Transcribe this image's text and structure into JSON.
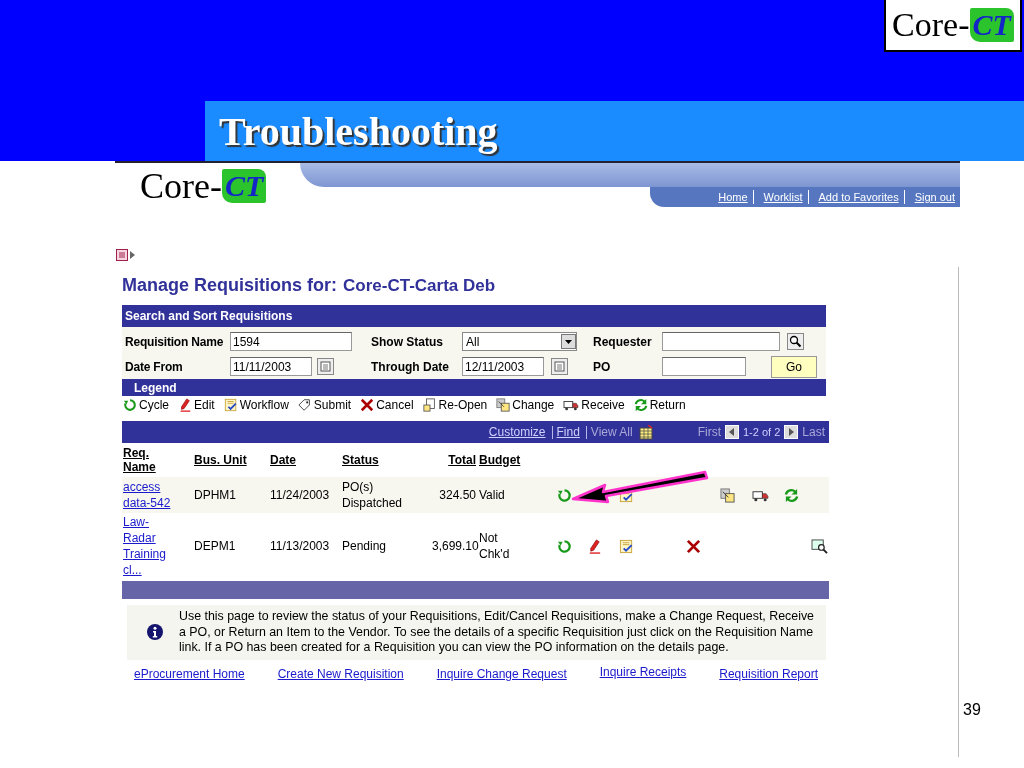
{
  "slide": {
    "title": "Troubleshooting",
    "logo": {
      "text": "Core-",
      "mark": "CT"
    },
    "page_number": "39"
  },
  "page": {
    "logo": {
      "text": "Core-",
      "mark": "CT"
    },
    "nav_links": [
      "Home",
      "Worklist",
      "Add to Favorites",
      "Sign out"
    ],
    "heading": {
      "label": "Manage Requisitions for:",
      "name": "Core-CT-Carta Deb"
    },
    "search": {
      "title": "Search and Sort Requisitions",
      "fields": [
        {
          "label": "Requisition Name",
          "kind": "text",
          "value": "1594"
        },
        {
          "label": "Show Status",
          "kind": "select",
          "value": "All"
        },
        {
          "label": "Requester",
          "kind": "lookup"
        },
        {
          "label": "Date From",
          "kind": "date",
          "value": "11/11/2003"
        },
        {
          "label": "Through Date",
          "kind": "date",
          "value": "12/11/2003"
        },
        {
          "label": "PO",
          "kind": "text"
        }
      ],
      "go_button": "Go"
    },
    "legend": {
      "title": "Legend",
      "items": [
        {
          "kind": "cycle",
          "label": "Cycle"
        },
        {
          "kind": "edit",
          "label": "Edit"
        },
        {
          "kind": "workflow",
          "label": "Workflow"
        },
        {
          "kind": "submit",
          "label": "Submit"
        },
        {
          "kind": "cancel",
          "label": "Cancel"
        },
        {
          "kind": "reopen",
          "label": "Re-Open"
        },
        {
          "kind": "change",
          "label": "Change"
        },
        {
          "kind": "receive",
          "label": "Receive"
        },
        {
          "kind": "return",
          "label": "Return"
        }
      ]
    },
    "grid": {
      "toolbar": {
        "links": [
          {
            "label": "Customize",
            "disabled": false
          },
          {
            "label": "Find",
            "disabled": false
          },
          {
            "label": "View All",
            "disabled": true
          }
        ],
        "pager": {
          "first": "First",
          "range": "1-2 of 2",
          "last": "Last"
        }
      },
      "columns": [
        "Req. Name",
        "Bus. Unit",
        "Date",
        "Status",
        "Total",
        "Budget"
      ],
      "rows": [
        {
          "req_name": "access data-542",
          "bus_unit": "DPHM1",
          "date": "11/24/2003",
          "status": "PO(s) Dispatched",
          "total": "324.50",
          "budget": "Valid",
          "actions": [
            {
              "kind": "cycle"
            },
            {
              "kind": "workflow"
            },
            {
              "kind": "change"
            },
            {
              "kind": "receive"
            },
            {
              "kind": "return"
            }
          ]
        },
        {
          "req_name": "Law-Radar Training cl...",
          "bus_unit": "DEPM1",
          "date": "11/13/2003",
          "status": "Pending",
          "total": "3,699.10",
          "budget": "Not Chk'd",
          "actions": [
            {
              "kind": "cycle"
            },
            {
              "kind": "edit"
            },
            {
              "kind": "workflow"
            },
            {
              "kind": "cancel"
            },
            {
              "kind": "view"
            }
          ]
        }
      ]
    },
    "info": "Use this page to review the status of your Requisitions, Edit/Cancel Requisitions, make a Change Request, Receive a PO, or Return an Item to the Vendor. To see the details of a specific Requisition just click on the Requisition Name link. If a PO has been created for a Requisition you can view the PO information on the details page.",
    "footer_links": [
      "eProcurement Home",
      "Create New Requisition",
      "Inquire Change Request",
      "Inquire Receipts",
      "Requisition Report"
    ]
  }
}
